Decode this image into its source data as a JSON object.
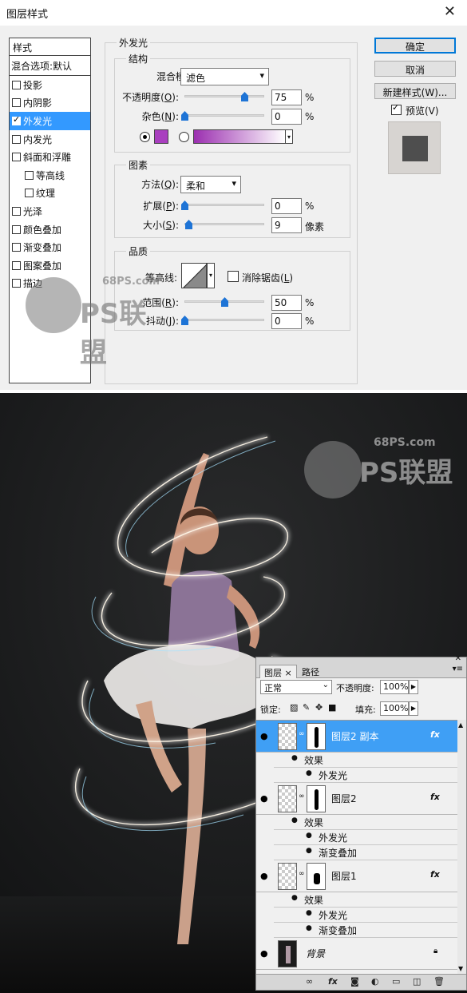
{
  "dialog": {
    "title": "图层样式",
    "close_glyph": "✕",
    "styles_header": "样式",
    "blend_options": "混合选项:默认",
    "styles": [
      {
        "label": "投影",
        "checked": false,
        "sub": false
      },
      {
        "label": "内阴影",
        "checked": false,
        "sub": false
      },
      {
        "label": "外发光",
        "checked": true,
        "sub": false,
        "active": true
      },
      {
        "label": "内发光",
        "checked": false,
        "sub": false
      },
      {
        "label": "斜面和浮雕",
        "checked": false,
        "sub": false
      },
      {
        "label": "等高线",
        "checked": false,
        "sub": true
      },
      {
        "label": "纹理",
        "checked": false,
        "sub": true
      },
      {
        "label": "光泽",
        "checked": false,
        "sub": false
      },
      {
        "label": "颜色叠加",
        "checked": false,
        "sub": false
      },
      {
        "label": "渐变叠加",
        "checked": false,
        "sub": false
      },
      {
        "label": "图案叠加",
        "checked": false,
        "sub": false
      },
      {
        "label": "描边",
        "checked": false,
        "sub": false
      }
    ],
    "outer_glow": {
      "title": "外发光",
      "structure": {
        "title": "结构",
        "blend_mode_label": "混合模式:",
        "blend_mode_value": "滤色",
        "opacity_label": "不透明度(",
        "opacity_key": "O",
        "opacity_value": "75",
        "opacity_pct": 0.75,
        "noise_label": "杂色(",
        "noise_key": "N",
        "noise_value": "0",
        "noise_pct": 0,
        "unit_percent": "%",
        "color_swatch": "#a93fbf",
        "gradient_from": "#9b2fb0",
        "gradient_to": "#ffffff"
      },
      "elements": {
        "title": "图素",
        "method_label": "方法(",
        "method_key": "Q",
        "method_value": "柔和",
        "spread_label": "扩展(",
        "spread_key": "P",
        "spread_value": "0",
        "spread_pct": 0,
        "size_label": "大小(",
        "size_key": "S",
        "size_value": "9",
        "size_pct": 0.05,
        "unit_percent": "%",
        "unit_pixels": "像素"
      },
      "quality": {
        "title": "品质",
        "contour_label": "等高线:",
        "antialias_label": "消除锯齿(",
        "antialias_key": "L",
        "range_label": "范围(",
        "range_key": "R",
        "range_value": "50",
        "range_pct": 0.5,
        "jitter_label": "抖动(",
        "jitter_key": "J",
        "jitter_value": "0",
        "jitter_pct": 0,
        "unit_percent": "%"
      }
    },
    "buttons": {
      "ok": "确定",
      "cancel": "取消",
      "new_style": "新建样式(W)...",
      "preview_label": "预览(V)",
      "preview_checked": true
    },
    "watermark": {
      "site": "68PS.com",
      "brand": "PS联盟"
    }
  },
  "photo": {
    "watermark": {
      "site": "68PS.com",
      "brand": "PS联盟"
    }
  },
  "layers_panel": {
    "close_glyph": "✕",
    "tabs": [
      {
        "label": "图层",
        "active": true,
        "close": "×"
      },
      {
        "label": "路径",
        "active": false
      }
    ],
    "blend_mode": "正常",
    "opacity_label": "不透明度:",
    "opacity_value": "100%",
    "lock_label": "锁定:",
    "fill_label": "填充:",
    "fill_value": "100%",
    "fx_glyph": "fx",
    "layers": [
      {
        "name": "图层2 副本",
        "selected": true,
        "effects_label": "效果",
        "effects": [
          "外发光"
        ]
      },
      {
        "name": "图层2",
        "selected": false,
        "effects_label": "效果",
        "effects": [
          "外发光",
          "渐变叠加"
        ]
      },
      {
        "name": "图层1",
        "selected": false,
        "effects_label": "效果",
        "effects": [
          "外发光",
          "渐变叠加"
        ]
      },
      {
        "name": "背景",
        "selected": false,
        "background": true
      }
    ],
    "bottom_icons": [
      "link-icon",
      "fx-icon",
      "mask-icon",
      "adjustment-icon",
      "folder-icon",
      "new-layer-icon",
      "trash-icon"
    ]
  }
}
